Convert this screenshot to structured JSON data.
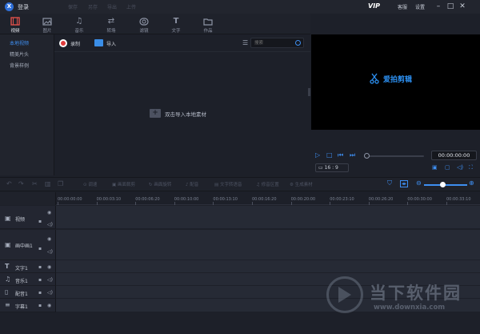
{
  "titlebar": {
    "logo_glyph": "X",
    "login_label": "登录",
    "menu": [
      "保存",
      "另存",
      "导出",
      "上传"
    ],
    "vip": "VIP",
    "service": "客服",
    "settings": "设置",
    "window_buttons": [
      "minimize-icon",
      "maximize-icon",
      "close-icon"
    ]
  },
  "media_tabs": [
    {
      "label": "视频",
      "icon": "video-icon",
      "active": true
    },
    {
      "label": "图片",
      "icon": "image-icon",
      "active": false
    },
    {
      "label": "音乐",
      "icon": "music-icon",
      "active": false
    },
    {
      "label": "转场",
      "icon": "transition-icon",
      "active": false
    },
    {
      "label": "滤镜",
      "icon": "filter-icon",
      "active": false
    },
    {
      "label": "文字",
      "icon": "text-icon",
      "active": false
    },
    {
      "label": "作品",
      "icon": "folder-icon",
      "active": false
    }
  ],
  "sidebar": {
    "items": [
      {
        "label": "本地视频",
        "active": true
      },
      {
        "label": "精美片头",
        "active": false
      },
      {
        "label": "背景样例",
        "active": false
      }
    ]
  },
  "media": {
    "record_label": "录制",
    "import_label": "导入",
    "search_placeholder": "搜索",
    "empty_hint": "双击导入本地素材"
  },
  "preview": {
    "logo_text": "爱拍剪辑",
    "time": "00:00:00:00",
    "ratio": "16 : 9"
  },
  "timeline_toolbar": {
    "buttons": [
      "调速",
      "画面裁剪",
      "画面旋转",
      "配音",
      "文字转语音",
      "修音区置",
      "生成素材"
    ]
  },
  "ruler": {
    "ticks": [
      "00:00:00:00",
      "00:00:03:10",
      "00:00:06:20",
      "00:00:10:00",
      "00:00:13:10",
      "00:00:16:20",
      "00:00:20:00",
      "00:00:23:10",
      "00:00:26:20",
      "00:00:30:00",
      "00:00:33:10"
    ]
  },
  "tracks": [
    {
      "label": "视频",
      "icon": "film-icon"
    },
    {
      "label": "画中画1",
      "icon": "pip-icon"
    },
    {
      "label": "文字1",
      "icon": "text-icon"
    },
    {
      "label": "音乐1",
      "icon": "music-icon"
    },
    {
      "label": "配音1",
      "icon": "voiceover-icon"
    },
    {
      "label": "字幕1",
      "icon": "subtitle-icon"
    }
  ],
  "watermark": {
    "text": "当下软件园",
    "url": "www.downxia.com"
  },
  "colors": {
    "accent": "#3e8ef0",
    "record": "#e03b3b",
    "background": "#1d2029"
  }
}
